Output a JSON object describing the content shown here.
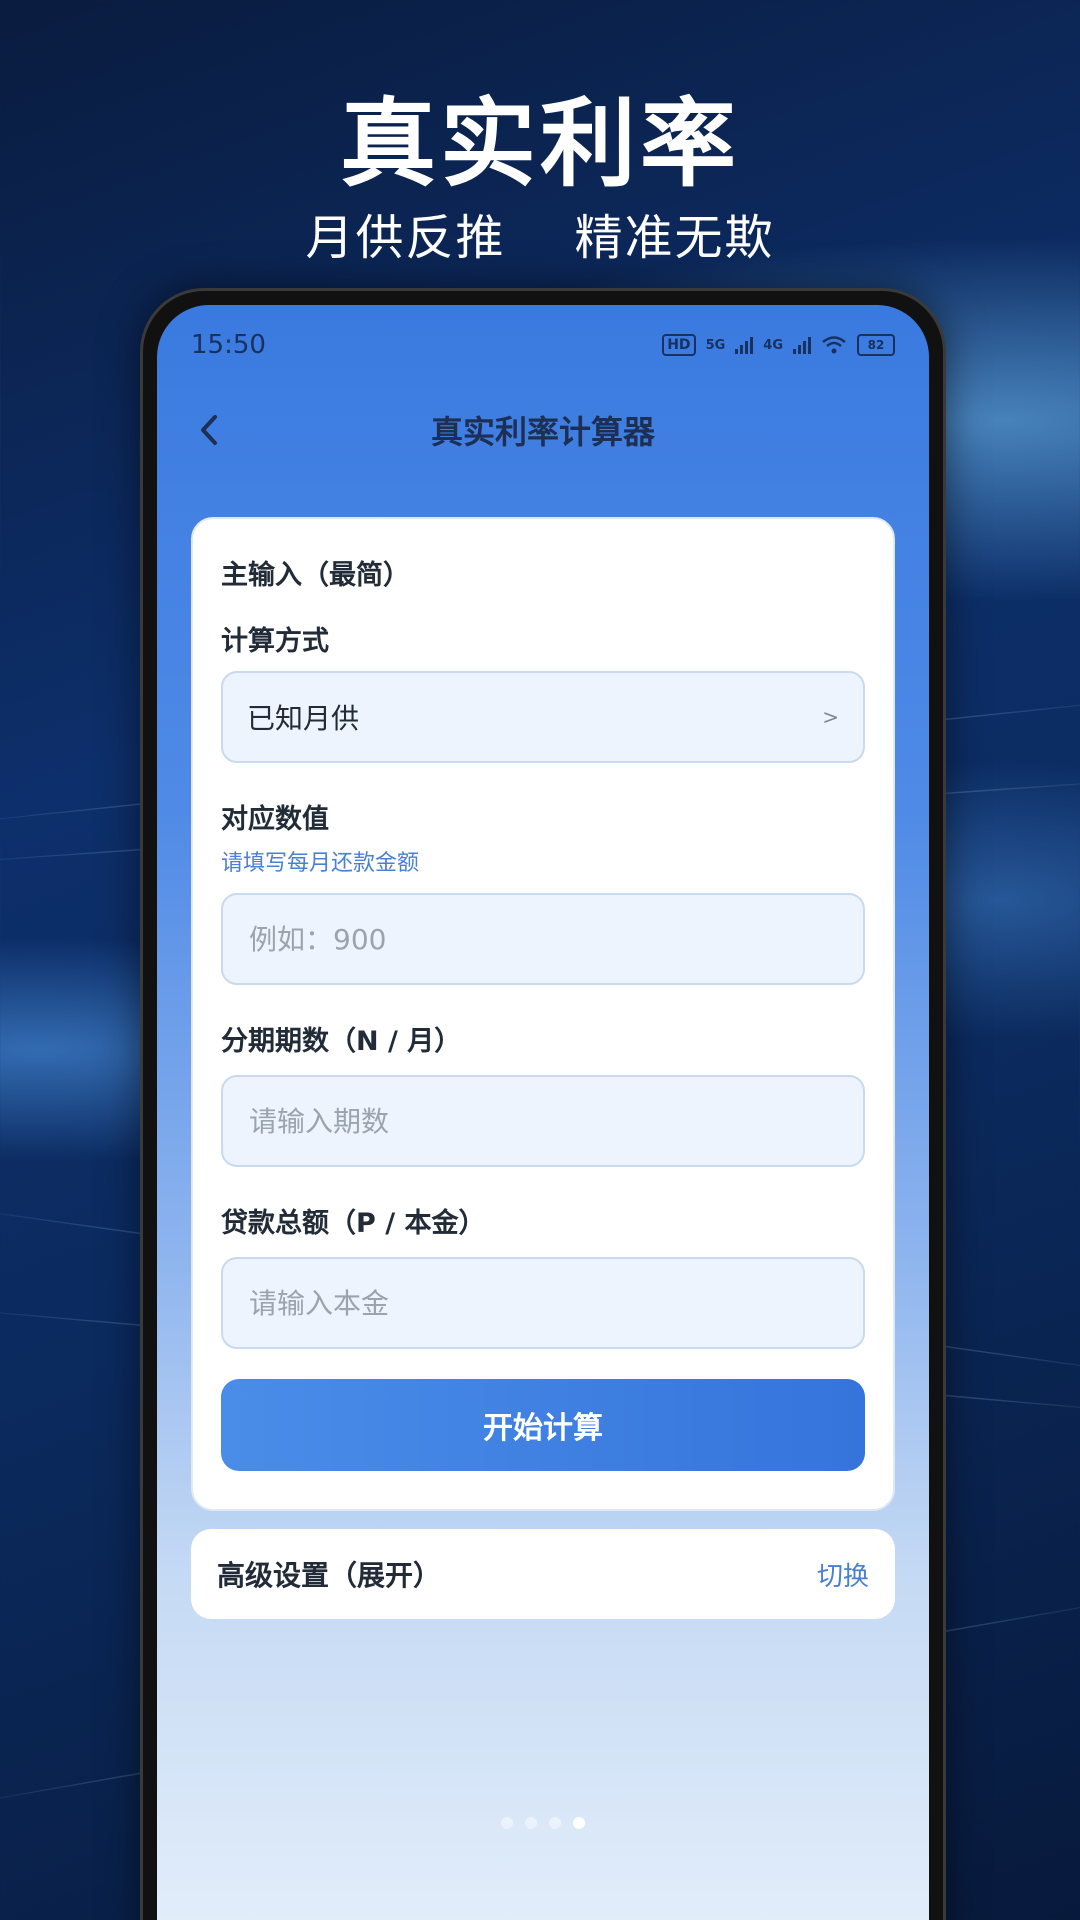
{
  "promo": {
    "title": "真实利率",
    "subtitle": "月供反推    精准无欺"
  },
  "status_bar": {
    "time": "15:50",
    "network_1": "5G",
    "network_2": "4G",
    "hd_badge": "HD",
    "battery": "82"
  },
  "nav": {
    "title": "真实利率计算器",
    "back_icon": "chevron-left-icon"
  },
  "form": {
    "section_title": "主输入（最简）",
    "mode_label": "计算方式",
    "mode_value": "已知月供",
    "mode_chevron": ">",
    "value_label": "对应数值",
    "value_hint": "请填写每月还款金额",
    "value_placeholder": "例如：900",
    "periods_label": "分期期数（N / 月）",
    "periods_placeholder": "请输入期数",
    "principal_label": "贷款总额（P / 本金）",
    "principal_placeholder": "请输入本金",
    "submit_label": "开始计算"
  },
  "advanced": {
    "label": "高级设置（展开）",
    "toggle_label": "切换"
  },
  "pager": {
    "total": 4,
    "active_index": 3
  },
  "colors": {
    "accent": "#3a7ae0",
    "hint_text": "#4a80d4",
    "field_bg": "#edf4fd"
  }
}
